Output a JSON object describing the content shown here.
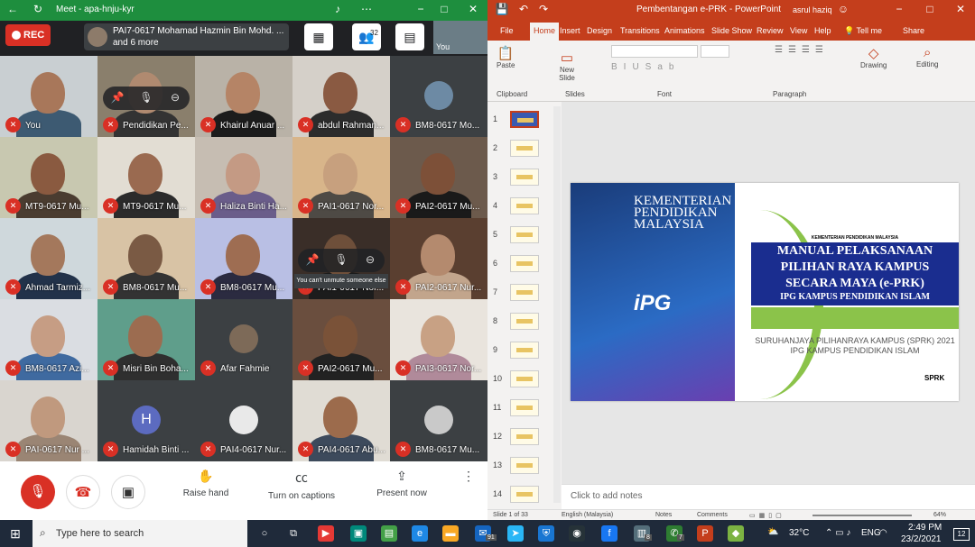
{
  "meet": {
    "window_title": "Meet - apa-hnju-kyr",
    "rec_label": "REC",
    "presenting": {
      "line1": "PAI7-0617 Mohamad Hazmin Bin Mohd. ...",
      "line2": "and 6 more"
    },
    "people_count": "32",
    "self_thumb_label": "You",
    "tiles": [
      {
        "name": "You",
        "kind": "video",
        "bg": "#c9cfd2",
        "skin": "#a8775a",
        "shirt": "#3d5a72"
      },
      {
        "name": "Pendidikan Pe...",
        "kind": "video",
        "bg": "#8a7f6c",
        "skin": "#b08a70",
        "shirt": "#333"
      },
      {
        "name": "Khairul Anuar ...",
        "kind": "video",
        "bg": "#b9b2a7",
        "skin": "#b58466",
        "shirt": "#1c1c1c"
      },
      {
        "name": "abdul Rahman...",
        "kind": "video",
        "bg": "#d5d0c9",
        "skin": "#8a5a42",
        "shirt": "#2c2c2c"
      },
      {
        "name": "BM8-0617 Mo...",
        "kind": "avatar",
        "avatar": "",
        "avatar_bg": "#6d8aa4"
      },
      {
        "name": "MT9-0617 Mu...",
        "kind": "video",
        "bg": "#c8c8b0",
        "skin": "#8a5a40",
        "shirt": "#4a3c30"
      },
      {
        "name": "MT9-0617 Mu...",
        "kind": "video",
        "bg": "#e2ddd3",
        "skin": "#9a6a50",
        "shirt": "#2b2b2b"
      },
      {
        "name": "Haliza Binti Ha...",
        "kind": "video",
        "bg": "#c6bdb2",
        "skin": "#c49a84",
        "shirt": "#6a5d8a"
      },
      {
        "name": "PAI1-0617 Nor...",
        "kind": "video",
        "bg": "#d8b58a",
        "skin": "#c7a07e",
        "shirt": "#4e4a45"
      },
      {
        "name": "PAI2-0617 Mu...",
        "kind": "video",
        "bg": "#6c5a4c",
        "skin": "#7d5038",
        "shirt": "#1a1a1a"
      },
      {
        "name": "Ahmad Tarmiz...",
        "kind": "video",
        "bg": "#cfd8dc",
        "skin": "#a4785c",
        "shirt": "#22324a"
      },
      {
        "name": "BM8-0617 Mu...",
        "kind": "video",
        "bg": "#d8c3a5",
        "skin": "#7a5a44",
        "shirt": "#333"
      },
      {
        "name": "BM8-0617 Mu...",
        "kind": "video",
        "bg": "#b9bfe4",
        "skin": "#9e6d52",
        "shirt": "#2b2b40"
      },
      {
        "name": "PAI1-0617 Nor...",
        "kind": "video",
        "bg": "#3a2e28",
        "skin": "#6e4f3a",
        "shirt": "#1c1c1c"
      },
      {
        "name": "PAI2-0617 Nur...",
        "kind": "video",
        "bg": "#5a3f30",
        "skin": "#b48a6e",
        "shirt": "#c2a58c"
      },
      {
        "name": "BM8-0617 Azi...",
        "kind": "video",
        "bg": "#dadde2",
        "skin": "#c69d84",
        "shirt": "#3f6aa0"
      },
      {
        "name": "Misri Bin Boha...",
        "kind": "video",
        "bg": "#5f9e8b",
        "skin": "#9c6c50",
        "shirt": "#2f2f2f"
      },
      {
        "name": "Afar Fahmie",
        "kind": "avatar",
        "avatar": "",
        "avatar_bg": "#7d6a58"
      },
      {
        "name": "PAI2-0617 Mu...",
        "kind": "video",
        "bg": "#6a4e3e",
        "skin": "#7a5238",
        "shirt": "#222"
      },
      {
        "name": "PAI3-0617 Nor...",
        "kind": "video",
        "bg": "#e9e4dd",
        "skin": "#c8a184",
        "shirt": "#b08a9a"
      },
      {
        "name": "PAI-0617 Nur ...",
        "kind": "video",
        "bg": "#d9d5cf",
        "skin": "#c0997e",
        "shirt": "#9a8574"
      },
      {
        "name": "Hamidah Binti ...",
        "kind": "avatar",
        "avatar": "H",
        "avatar_bg": "#5c6bc0"
      },
      {
        "name": "PAI4-0617 Nur...",
        "kind": "avatar",
        "avatar": "",
        "avatar_bg": "#e9e9e9"
      },
      {
        "name": "PAI4-0617 Abu...",
        "kind": "video",
        "bg": "#e0dcd4",
        "skin": "#9c6b4c",
        "shirt": "#3d4a5c"
      },
      {
        "name": "BM8-0617 Mu...",
        "kind": "avatar",
        "avatar": "",
        "avatar_bg": "#c9c9c9"
      }
    ],
    "tooltip": "You can't unmute someone else",
    "controls": {
      "raise_hand": "Raise hand",
      "captions": "Turn on captions",
      "present": "Present now"
    }
  },
  "ppt": {
    "window_title": "Pembentangan e-PRK  -  PowerPoint",
    "user": "asrul haziq",
    "tabs": [
      "File",
      "Home",
      "Insert",
      "Design",
      "Transitions",
      "Animations",
      "Slide Show",
      "Review",
      "View",
      "Help"
    ],
    "tell_me": "Tell me",
    "share": "Share",
    "groups": {
      "clipboard": "Clipboard",
      "slides": "Slides",
      "font": "Font",
      "paragraph": "Paragraph"
    },
    "buttons": {
      "paste": "Paste",
      "new_slide": "New Slide",
      "drawing": "Drawing",
      "editing": "Editing"
    },
    "slide_numbers": [
      "1",
      "2",
      "3",
      "4",
      "5",
      "6",
      "7",
      "8",
      "9",
      "10",
      "11",
      "12",
      "13",
      "14"
    ],
    "slide": {
      "kementerian": "KEMENTERIAN PENDIDIKAN MALAYSIA",
      "kp_small": "KEMENTERIAN PENDIDIKAN MALAYSIA",
      "title1": "MANUAL PELAKSANAAN",
      "title2": "PILIHAN RAYA KAMPUS",
      "title3": "SECARA MAYA (e-PRK)",
      "title4": "IPG KAMPUS PENDIDIKAN ISLAM",
      "sub1": "SURUHANJAYA PILIHANRAYA KAMPUS (SPRK) 2021",
      "sub2": "IPG KAMPUS PENDIDIKAN ISLAM",
      "ipg": "iPG",
      "sprk": "SPRK"
    },
    "notes_placeholder": "Click to add notes",
    "status": {
      "slide": "Slide 1 of 33",
      "lang": "English (Malaysia)",
      "notes": "Notes",
      "comments": "Comments",
      "zoom": "64%"
    }
  },
  "taskbar": {
    "search_placeholder": "Type here to search",
    "temp": "32°C",
    "lang": "ENG",
    "time": "2:49 PM",
    "date": "23/2/2021",
    "notif": "12",
    "badge1": "91",
    "badge2": "8",
    "badge3": "7"
  }
}
